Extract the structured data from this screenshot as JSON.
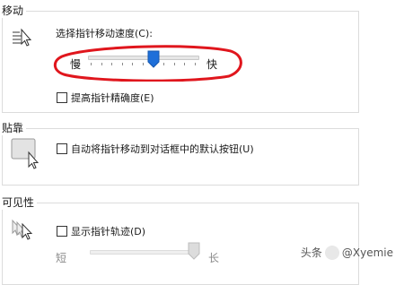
{
  "groups": {
    "motion": {
      "title": "移动",
      "speed_label": "选择指针移动速度(C):",
      "slow": "慢",
      "fast": "快",
      "speed_value": 0.6,
      "precision_label": "提高指针精确度(E)"
    },
    "snap": {
      "title": "贴靠",
      "snap_label": "自动将指针移动到对话框中的默认按钮(U)"
    },
    "visibility": {
      "title": "可见性",
      "trails_label": "显示指针轨迹(D)",
      "short": "短",
      "long": "长",
      "trail_value": 1.0
    }
  },
  "watermark": {
    "prefix": "头条",
    "handle": "@Xyemie"
  },
  "colors": {
    "slider_thumb": "#1e6fd9",
    "annotation_circle": "#e0161d"
  }
}
